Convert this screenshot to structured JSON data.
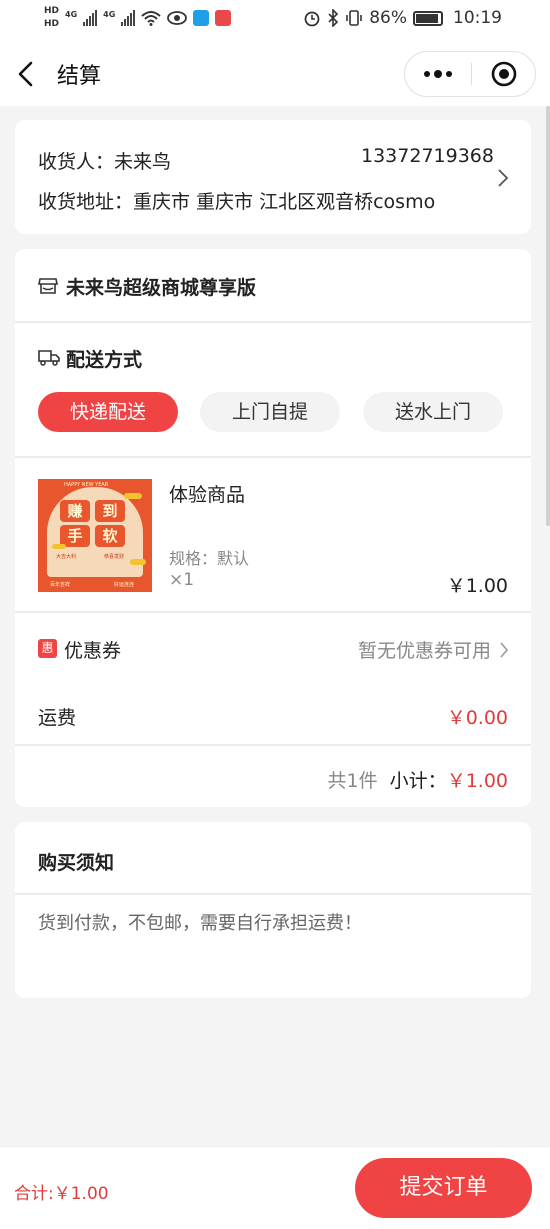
{
  "status_bar": {
    "net1": "HD",
    "net2": "HD",
    "sig1_label": "4G",
    "sig2_label": "4G",
    "battery_pct": "86%",
    "time": "10:19"
  },
  "nav": {
    "title": "结算"
  },
  "address": {
    "receiver_label": "收货人：",
    "receiver_name": "未来鸟",
    "phone": "13372719368",
    "address_label": "收货地址：",
    "address": "重庆市 重庆市 江北区观音桥cosmo"
  },
  "shop": {
    "name": "未来鸟超级商城尊享版"
  },
  "delivery": {
    "title": "配送方式",
    "options": [
      {
        "label": "快递配送",
        "active": true
      },
      {
        "label": "上门自提",
        "active": false
      },
      {
        "label": "送水上门",
        "active": false
      }
    ]
  },
  "product": {
    "name": "体验商品",
    "spec": "规格：默认",
    "qty": "×1",
    "price": "￥1.00",
    "image_text": {
      "top": "HAPPY   NEW   YEAR",
      "chars": [
        "赚",
        "到",
        "手",
        "软"
      ],
      "left_vertical": "大吉大利",
      "right_vertical": "恭喜发财",
      "bottom_left": "百年吉祥",
      "bottom_right": "好运连连"
    }
  },
  "coupon": {
    "badge": "惠",
    "label": "优惠券",
    "value": "暂无优惠券可用"
  },
  "freight": {
    "label": "运费",
    "value": "￥0.00"
  },
  "subtotal": {
    "count": "共1件",
    "label": "小计：",
    "value": "￥1.00"
  },
  "notice": {
    "title": "购买须知",
    "content": "货到付款，不包邮，需要自行承担运费！"
  },
  "bottom": {
    "total": "合计:￥1.00",
    "submit": "提交订单"
  },
  "colors": {
    "accent": "#f04444",
    "price_red": "#e03c3c",
    "background": "#f4f4f4"
  }
}
